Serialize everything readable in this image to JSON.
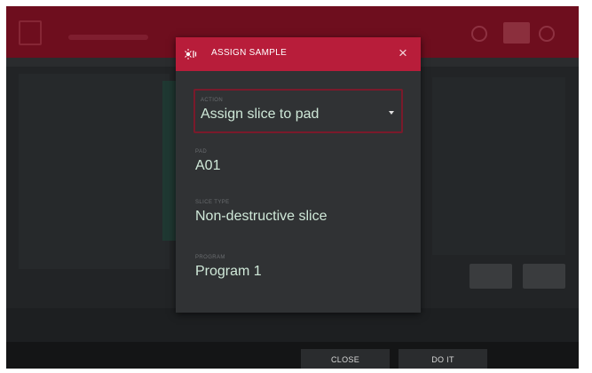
{
  "dialog": {
    "title": "ASSIGN SAMPLE",
    "close_glyph": "×",
    "icon": "slice-icon",
    "accent_color": "#b81d3a"
  },
  "fields": {
    "action": {
      "caption": "Action",
      "value": "Assign slice to pad"
    },
    "pad": {
      "caption": "Pad",
      "value": "A01"
    },
    "slice_type": {
      "caption": "Slice Type",
      "value": "Non-destructive slice"
    },
    "program": {
      "caption": "Program",
      "value": "Program 1"
    }
  },
  "footer": {
    "close_label": "CLOSE",
    "do_it_label": "DO IT"
  }
}
